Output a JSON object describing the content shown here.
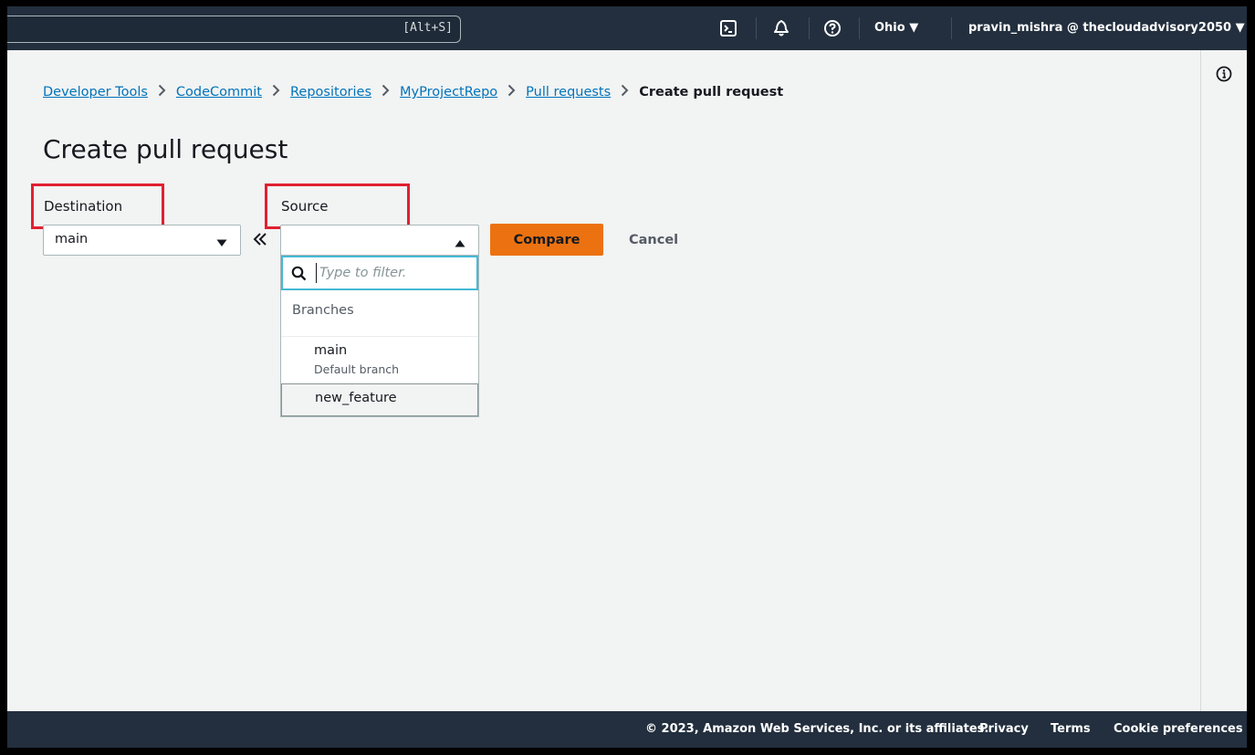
{
  "topbar": {
    "search_shortcut": "[Alt+S]",
    "region": "Ohio ▼",
    "account": "pravin_mishra @ thecloudadvisory2050 ▼",
    "icons": [
      "cloudshell-icon",
      "bell-icon",
      "help-icon"
    ]
  },
  "breadcrumb": {
    "items": [
      "Developer Tools",
      "CodeCommit",
      "Repositories",
      "MyProjectRepo",
      "Pull requests"
    ],
    "current": "Create pull request"
  },
  "page": {
    "title": "Create pull request"
  },
  "form": {
    "destination_label": "Destination",
    "destination_value": "main",
    "source_label": "Source",
    "source_value": "",
    "compare_label": "Compare",
    "cancel_label": "Cancel"
  },
  "dropdown": {
    "filter_placeholder": "Type to filter.",
    "group_label": "Branches",
    "options": [
      {
        "label": "main",
        "description": "Default branch"
      },
      {
        "label": "new_feature",
        "description": ""
      }
    ]
  },
  "footer": {
    "copyright": "© 2023, Amazon Web Services, Inc. or its affiliates.",
    "privacy": "Privacy",
    "terms": "Terms",
    "cookies": "Cookie preferences"
  },
  "colors": {
    "topbar": "#232f3e",
    "primary_button": "#ec7211",
    "link": "#0073bb",
    "highlight_box": "#e02030",
    "focus_ring": "#44b9d6"
  }
}
